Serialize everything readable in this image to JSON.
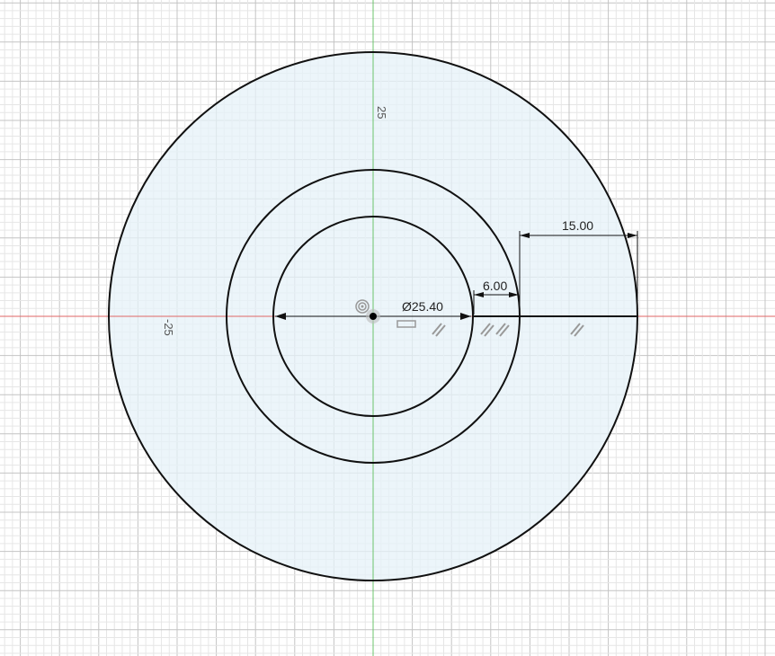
{
  "sketch": {
    "axis_labels": {
      "y_positive": "25",
      "x_negative": "-25"
    },
    "dimensions": {
      "diameter": "Ø25.40",
      "offset_inner": "6.00",
      "offset_outer": "15.00"
    },
    "units": "mm",
    "circles_mm_diameter": [
      25.4,
      37.4,
      67.4
    ],
    "colors": {
      "fill": "#e6f2f8",
      "x_axis": "#d9534f",
      "y_axis": "#5cb85c",
      "line": "#111111"
    }
  }
}
